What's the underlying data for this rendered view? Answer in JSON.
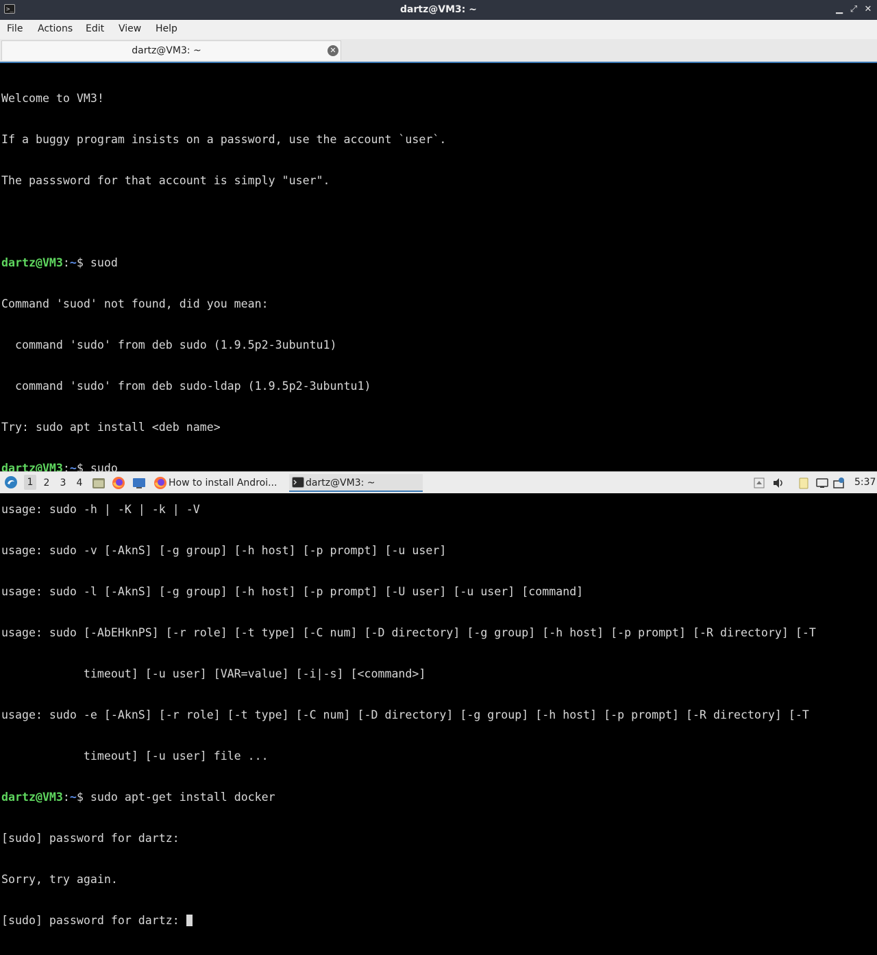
{
  "window": {
    "title": "dartz@VM3: ~",
    "app_icon_glyph": ">_",
    "minimize_glyph": "▁",
    "maximize_glyph": "⤢",
    "close_glyph": "✕"
  },
  "menu": {
    "file": "File",
    "actions": "Actions",
    "edit": "Edit",
    "view": "View",
    "help": "Help"
  },
  "tab": {
    "label": "dartz@VM3: ~",
    "close_glyph": "✕"
  },
  "terminal": {
    "prompt_user": "dartz@VM3",
    "prompt_sep": ":",
    "prompt_path": "~",
    "prompt_symbol": "$ ",
    "line_1": "Welcome to VM3!",
    "line_2": "If a buggy program insists on a password, use the account `user`.",
    "line_3": "The passsword for that account is simply \"user\".",
    "cmd_1": "suod",
    "line_6": "Command 'suod' not found, did you mean:",
    "line_7": "  command 'sudo' from deb sudo (1.9.5p2-3ubuntu1)",
    "line_8": "  command 'sudo' from deb sudo-ldap (1.9.5p2-3ubuntu1)",
    "line_9": "Try: sudo apt install <deb name>",
    "cmd_2": "sudo",
    "line_11": "usage: sudo -h | -K | -k | -V",
    "line_12": "usage: sudo -v [-AknS] [-g group] [-h host] [-p prompt] [-u user]",
    "line_13": "usage: sudo -l [-AknS] [-g group] [-h host] [-p prompt] [-U user] [-u user] [command]",
    "line_14": "usage: sudo [-AbEHknPS] [-r role] [-t type] [-C num] [-D directory] [-g group] [-h host] [-p prompt] [-R directory] [-T",
    "line_15": "            timeout] [-u user] [VAR=value] [-i|-s] [<command>]",
    "line_16": "usage: sudo -e [-AknS] [-r role] [-t type] [-C num] [-D directory] [-g group] [-h host] [-p prompt] [-R directory] [-T",
    "line_17": "            timeout] [-u user] file ...",
    "cmd_3": "sudo apt-get install docker",
    "line_19": "[sudo] password for dartz:",
    "line_20": "Sorry, try again.",
    "line_21": "[sudo] password for dartz: "
  },
  "taskbar": {
    "workspaces": [
      "1",
      "2",
      "3",
      "4"
    ],
    "tasks": [
      {
        "label": "How to install Androi..."
      },
      {
        "label": "dartz@VM3: ~"
      }
    ],
    "clock": "5:37",
    "colors": {
      "accent": "#3c7ab5",
      "prompt_user": "#5fd75f",
      "prompt_path": "#5c8ee8"
    }
  }
}
